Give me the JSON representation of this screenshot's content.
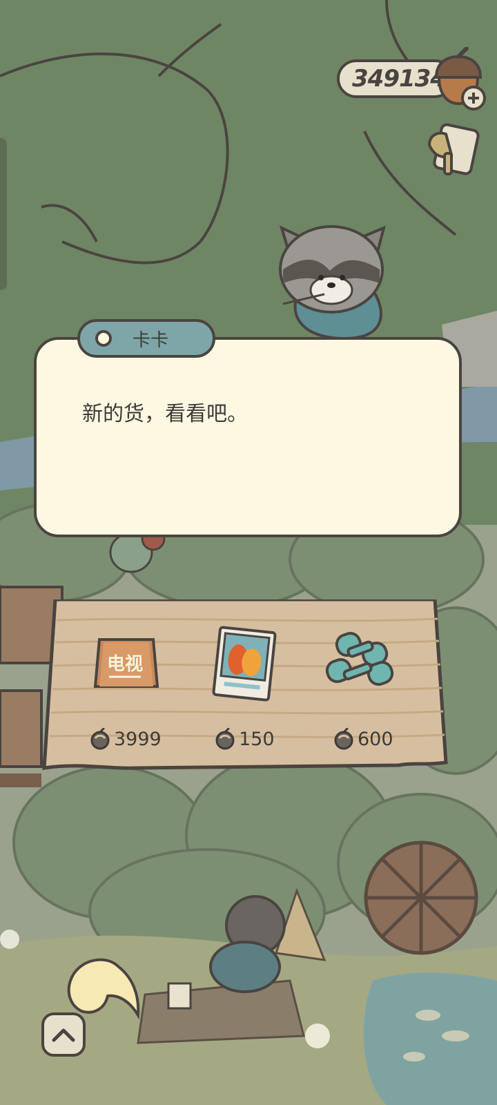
{
  "hud": {
    "acorn_count": "349134",
    "acorn_icon": "acorn-plus-icon",
    "tool_icon": "hammer-tool-icon"
  },
  "dialog": {
    "speaker": "卡卡",
    "text": "新的货，看看吧。"
  },
  "shop": {
    "items": [
      {
        "name": "tv-sign",
        "icon_text": "电视",
        "price": "3999"
      },
      {
        "name": "photo-card",
        "price": "150"
      },
      {
        "name": "dumbbell",
        "price": "600"
      }
    ]
  },
  "colors": {
    "dialog_bg": "#fdf8e2",
    "name_tag": "#7ea6a8",
    "outline": "#4a4440",
    "board": "#d6bfa0"
  }
}
